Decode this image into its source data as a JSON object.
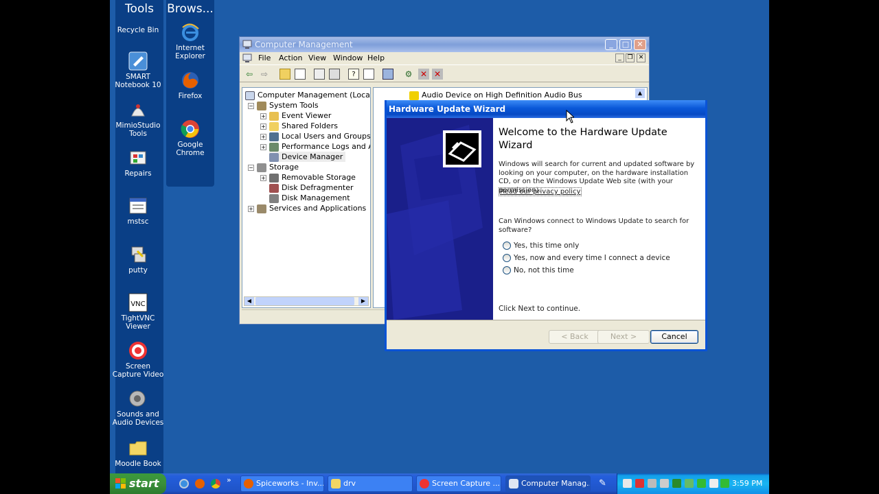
{
  "desktop": {
    "toolbar_tools": {
      "title": "Tools",
      "icons": [
        {
          "label": "Recycle Bin",
          "icon": "recycle-bin-icon"
        },
        {
          "label": "SMART Notebook 10",
          "icon": "smart-notebook-icon"
        },
        {
          "label": "MimioStudio Tools",
          "icon": "mimiostudio-icon"
        },
        {
          "label": "Repairs",
          "icon": "repairs-icon"
        },
        {
          "label": "mstsc",
          "icon": "remote-desktop-icon"
        },
        {
          "label": "putty",
          "icon": "putty-icon"
        },
        {
          "label": "TightVNC Viewer",
          "icon": "tightvnc-icon"
        },
        {
          "label": "Screen Capture Video",
          "icon": "screen-capture-icon"
        },
        {
          "label": "Sounds and Audio Devices",
          "icon": "speaker-icon"
        },
        {
          "label": "Moodle Book",
          "icon": "folder-icon"
        }
      ]
    },
    "toolbar_browsers": {
      "title": "Brows...",
      "icons": [
        {
          "label": "Internet Explorer",
          "icon": "internet-explorer-icon"
        },
        {
          "label": "Firefox",
          "icon": "firefox-icon"
        },
        {
          "label": "Google Chrome",
          "icon": "chrome-icon"
        }
      ]
    }
  },
  "computer_management": {
    "title": "Computer Management",
    "menu": [
      "File",
      "Action",
      "View",
      "Window",
      "Help"
    ],
    "tree": [
      {
        "label": "Computer Management (Local)",
        "level": 0
      },
      {
        "label": "System Tools",
        "level": 1,
        "expander": "−"
      },
      {
        "label": "Event Viewer",
        "level": 2,
        "expander": "+"
      },
      {
        "label": "Shared Folders",
        "level": 2,
        "expander": "+"
      },
      {
        "label": "Local Users and Groups",
        "level": 2,
        "expander": "+"
      },
      {
        "label": "Performance Logs and Alerts",
        "level": 2,
        "expander": "+"
      },
      {
        "label": "Device Manager",
        "level": 2,
        "expander": ""
      },
      {
        "label": "Storage",
        "level": 1,
        "expander": "−"
      },
      {
        "label": "Removable Storage",
        "level": 2,
        "expander": "+"
      },
      {
        "label": "Disk Defragmenter",
        "level": 2,
        "expander": ""
      },
      {
        "label": "Disk Management",
        "level": 2,
        "expander": ""
      },
      {
        "label": "Services and Applications",
        "level": 1,
        "expander": "+"
      }
    ],
    "right_pane_item": "Audio Device on High Definition Audio Bus"
  },
  "wizard": {
    "title": "Hardware Update Wizard",
    "heading": "Welcome to the Hardware Update Wizard",
    "intro": "Windows will search for current and updated software by looking on your computer, on the hardware installation CD, or on the Windows Update Web site (with your permission).",
    "privacy_link": "Read our privacy policy",
    "question": "Can Windows connect to Windows Update to search for software?",
    "options": [
      "Yes, this time only",
      "Yes, now and every time I connect a device",
      "No, not this time"
    ],
    "continue_text": "Click Next to continue.",
    "back_label": "< Back",
    "next_label": "Next >",
    "cancel_label": "Cancel"
  },
  "taskbar": {
    "start_label": "start",
    "quick_launch_more": "»",
    "tasks": [
      {
        "label": "Spiceworks - Inv...",
        "icon": "firefox-icon"
      },
      {
        "label": "drv",
        "icon": "folder-icon"
      },
      {
        "label": "Screen Capture ...",
        "icon": "screen-capture-icon"
      },
      {
        "label": "Computer Manag...",
        "icon": "computer-icon"
      }
    ],
    "clock": "3:59 PM"
  }
}
